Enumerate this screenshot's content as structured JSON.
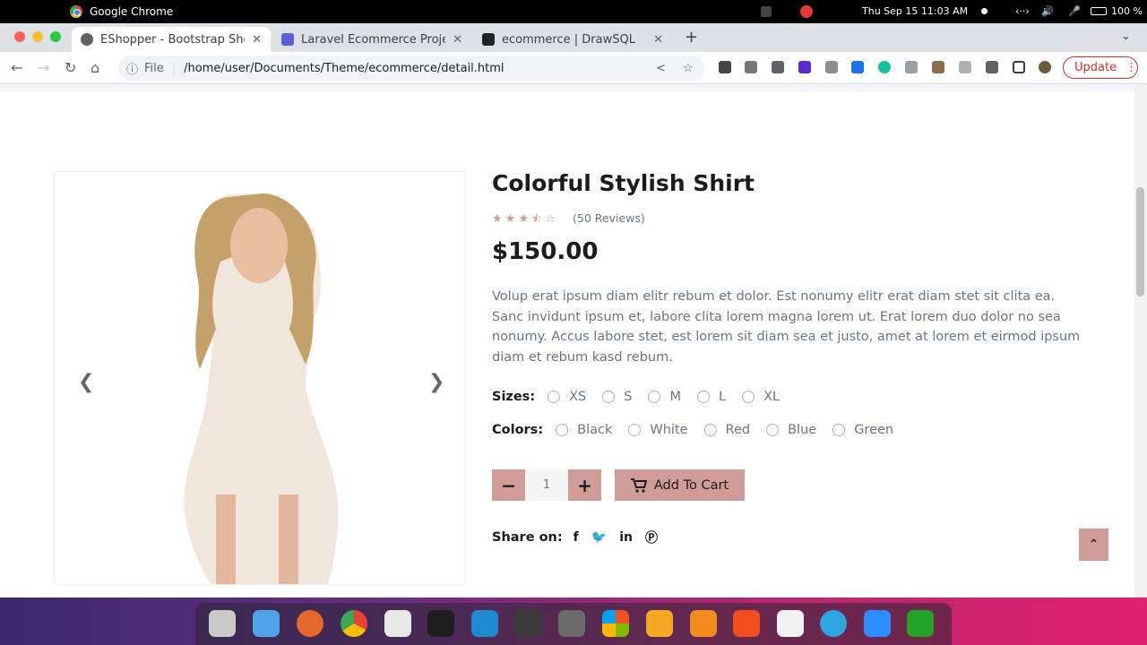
{
  "os": {
    "app_name": "Google Chrome",
    "datetime": "Thu Sep 15  11:03 AM",
    "battery": "100 %"
  },
  "tabs": [
    {
      "title": "EShopper - Bootstrap Sho",
      "active": true
    },
    {
      "title": "Laravel Ecommerce Proje",
      "active": false
    },
    {
      "title": "ecommerce | DrawSQL",
      "active": false
    }
  ],
  "address": {
    "scheme": "File",
    "url": "/home/user/Documents/Theme/ecommerce/detail.html"
  },
  "toolbar": {
    "update_label": "Update"
  },
  "product": {
    "title": "Colorful Stylish Shirt",
    "rating": 3.5,
    "reviews": "(50 Reviews)",
    "price": "$150.00",
    "description": "Volup erat ipsum diam elitr rebum et dolor. Est nonumy elitr erat diam stet sit clita ea. Sanc invidunt ipsum et, labore clita lorem magna lorem ut. Erat lorem duo dolor no sea nonumy. Accus labore stet, est lorem sit diam sea et justo, amet at lorem et eirmod ipsum diam et rebum kasd rebum.",
    "sizes_label": "Sizes:",
    "sizes": [
      "XS",
      "S",
      "M",
      "L",
      "XL"
    ],
    "colors_label": "Colors:",
    "colors": [
      "Black",
      "White",
      "Red",
      "Blue",
      "Green"
    ],
    "quantity": "1",
    "add_to_cart": "Add To Cart",
    "share_label": "Share on:"
  },
  "theme": {
    "accent": "#D19C97",
    "text": "#1C1C1C",
    "muted": "#6C757D"
  }
}
